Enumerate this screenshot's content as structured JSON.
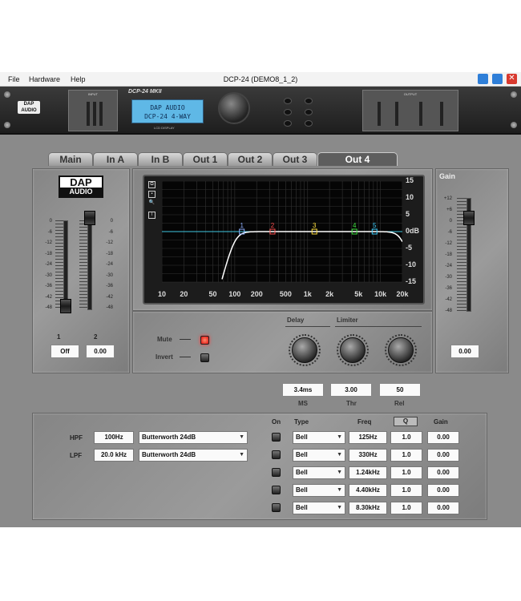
{
  "menu": {
    "file": "File",
    "hardware": "Hardware",
    "help": "Help"
  },
  "window": {
    "title": "DCP-24 (DEMO8_1_2)"
  },
  "rack": {
    "model": "DCP-24 MKII",
    "lcd_line1": "DAP AUDIO",
    "lcd_line2": "DCP-24 4-WAY",
    "lcd_caption": "LCD DISPLAY",
    "input_label": "INPUT",
    "output_label": "OUTPUT",
    "logo": "DAP AUDIO"
  },
  "tabs": [
    {
      "label": "Main",
      "active": false
    },
    {
      "label": "In A",
      "active": false
    },
    {
      "label": "In B",
      "active": false
    },
    {
      "label": "Out 1",
      "active": false
    },
    {
      "label": "Out 2",
      "active": false
    },
    {
      "label": "Out 3",
      "active": false
    },
    {
      "label": "Out 4",
      "active": true
    }
  ],
  "left_panel": {
    "logo_top": "DAP",
    "logo_bottom": "AUDIO",
    "scale": [
      "0",
      "-6",
      "-12",
      "-18",
      "-24",
      "-30",
      "-36",
      "-42",
      "-48"
    ],
    "fader1_label": "1",
    "fader2_label": "2",
    "off_button": "Off",
    "value": "0.00"
  },
  "eq_graph": {
    "y_ticks": [
      "15",
      "10",
      "5",
      "0dB",
      "-5",
      "-10",
      "-15"
    ],
    "x_ticks": [
      "10",
      "20",
      "50",
      "100",
      "200",
      "500",
      "1k",
      "2k",
      "5k",
      "10k",
      "20k"
    ],
    "band_markers": [
      {
        "label": "1",
        "color": "#8fb0ff"
      },
      {
        "label": "2",
        "color": "#ff5050"
      },
      {
        "label": "3",
        "color": "#ffe040"
      },
      {
        "label": "4",
        "color": "#40e040"
      },
      {
        "label": "5",
        "color": "#40d0ff"
      }
    ],
    "curve_color": "#ffffff",
    "flat_line_color": "#40c8e0"
  },
  "gain_panel": {
    "title": "Gain",
    "scale": [
      "+12",
      "+6",
      "0",
      "-6",
      "-12",
      "-18",
      "-24",
      "-30",
      "-36",
      "-42",
      "-48"
    ],
    "value": "0.00"
  },
  "controls": {
    "mute_label": "Mute",
    "invert_label": "Invert",
    "delay_label": "Delay",
    "limiter_label": "Limiter",
    "delay_value": "3.4ms",
    "delay_unit": "MS",
    "thr_value": "3.00",
    "thr_label": "Thr",
    "rel_value": "50",
    "rel_label": "Rel"
  },
  "filters": {
    "hpf_label": "HPF",
    "hpf_freq": "100Hz",
    "hpf_type": "Butterworth 24dB",
    "lpf_label": "LPF",
    "lpf_freq": "20.0 kHz",
    "lpf_type": "Butterworth 24dB"
  },
  "peq": {
    "headers": {
      "on": "On",
      "type": "Type",
      "freq": "Freq",
      "q": "Q",
      "gain": "Gain"
    },
    "bands": [
      {
        "type": "Bell",
        "freq": "125Hz",
        "q": "1.0",
        "gain": "0.00"
      },
      {
        "type": "Bell",
        "freq": "330Hz",
        "q": "1.0",
        "gain": "0.00"
      },
      {
        "type": "Bell",
        "freq": "1.24kHz",
        "q": "1.0",
        "gain": "0.00"
      },
      {
        "type": "Bell",
        "freq": "4.40kHz",
        "q": "1.0",
        "gain": "0.00"
      },
      {
        "type": "Bell",
        "freq": "8.30kHz",
        "q": "1.0",
        "gain": "0.00"
      }
    ]
  }
}
